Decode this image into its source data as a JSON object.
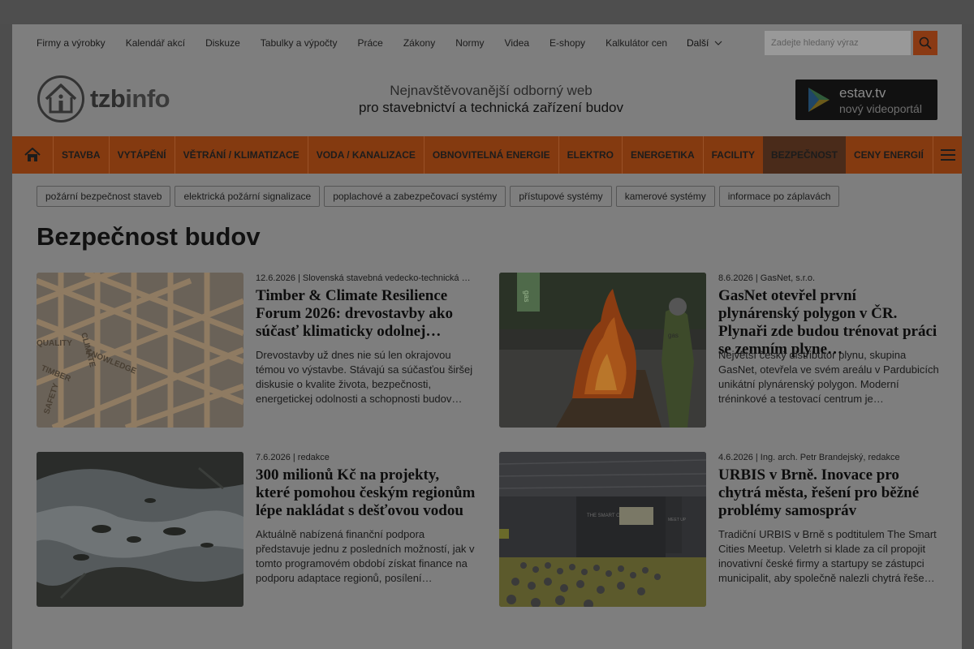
{
  "utility_nav": {
    "links": [
      "Firmy a výrobky",
      "Kalendář akcí",
      "Diskuze",
      "Tabulky a výpočty",
      "Práce",
      "Zákony",
      "Normy",
      "Videa",
      "E-shopy",
      "Kalkulátor cen"
    ],
    "more_label": "Další",
    "search_placeholder": "Zadejte hledaný výraz"
  },
  "header": {
    "logo_part1": "tzb",
    "logo_part2": "info",
    "tagline_line1": "Nejnavštěvovanější odborný web",
    "tagline_line2": "pro stavebnictví a technická zařízení budov",
    "estav_title": "estav.tv",
    "estav_subtitle": "nový videoportál"
  },
  "main_nav": {
    "items": [
      "STAVBA",
      "VYTÁPĚNÍ",
      "VĚTRÁNÍ / KLIMATIZACE",
      "VODA / KANALIZACE",
      "OBNOVITELNÁ ENERGIE",
      "ELEKTRO",
      "ENERGETIKA",
      "FACILITY",
      "BEZPEČNOST",
      "CENY ENERGIÍ"
    ],
    "active": "BEZPEČNOST"
  },
  "tags": [
    "požární bezpečnost staveb",
    "elektrická požární signalizace",
    "poplachové a zabezpečovací systémy",
    "přístupové systémy",
    "kamerové systémy",
    "informace po záplavách"
  ],
  "page_title": "Bezpečnost budov",
  "articles": [
    {
      "meta": "12.6.2026 | Slovenská stavebná vedecko-technická …",
      "title": "Timber & Climate Resilience Forum 2026: drevostavby ako súčasť klimaticky odolnej…",
      "perex": "Drevostavby už dnes nie sú len okrajovou témou vo výstavbe. Stávajú sa súčasťou širšej diskusie o kvalite života, bezpečnosti, energetickej odolnosti a schopnosti budov…",
      "image_text": [
        "SAFETY",
        "CLIMATE",
        "TIMBER",
        "KNOWLEDGE",
        "QUALITY"
      ]
    },
    {
      "meta": "8.6.2026 | GasNet, s.r.o.",
      "title": "GasNet otevřel první plynárenský polygon v ČR. Plynaři zde budou trénovat práci se zemním plyne…",
      "perex": "Největší český distributor plynu, skupina GasNet, otevřela ve svém areálu v Pardubicích unikátní plynárenský polygon. Moderní tréninkové a testovací centrum je…",
      "image_text": [
        "gas"
      ]
    },
    {
      "meta": "7.6.2026 | redakce",
      "title": "300 milionů Kč na projekty, které pomohou českým regionům lépe nakládat s dešťovou vodou",
      "perex": "Aktuálně nabízená finanční podpora představuje jednu z posledních možností, jak v tomto programovém období získat finance na podporu adaptace regionů, posílení…",
      "image_text": []
    },
    {
      "meta": "4.6.2026 | Ing. arch. Petr Brandejský, redakce",
      "title": "URBIS v Brně. Inovace pro chytrá města, řešení pro běžné problémy samospráv",
      "perex": "Tradiční URBIS v Brně s podtitulem The Smart Cities Meetup. Veletrh si klade za cíl propojit inovativní české firmy a startupy se zástupci municipalit, aby společně nalezli chytrá řeše…",
      "image_text": [
        "THE SMART CITIES",
        "MEET UP"
      ]
    }
  ],
  "colors": {
    "accent": "#843a10",
    "active_nav": "#4a2b1a",
    "overlay_bg": "#7e7e7e"
  }
}
